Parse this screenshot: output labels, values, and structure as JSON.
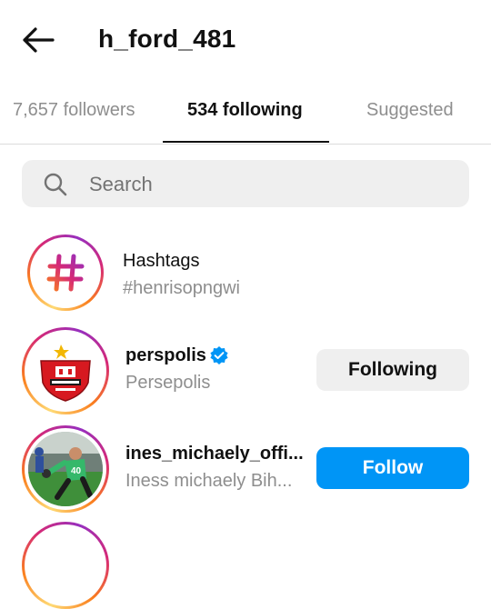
{
  "header": {
    "title": "h_ford_481"
  },
  "tabs": [
    {
      "label": "7,657 followers",
      "active": false
    },
    {
      "label": "534 following",
      "active": true
    },
    {
      "label": "Suggested",
      "active": false
    }
  ],
  "search": {
    "placeholder": "Search"
  },
  "hashtags_row": {
    "title": "Hashtags",
    "subtitle": "#henrisopngwi"
  },
  "accounts": [
    {
      "username": "perspolis",
      "full_name": "Persepolis",
      "verified": true,
      "button": "Following"
    },
    {
      "username": "ines_michaely_offi...",
      "full_name": "Iness michaely Bih...",
      "verified": false,
      "button": "Follow"
    }
  ],
  "colors": {
    "accent": "#0095f6",
    "verified": "#0095f6",
    "muted": "#8e8e8e"
  },
  "icons": [
    "back-arrow-icon",
    "search-icon",
    "hashtag-icon",
    "verified-badge-icon"
  ]
}
